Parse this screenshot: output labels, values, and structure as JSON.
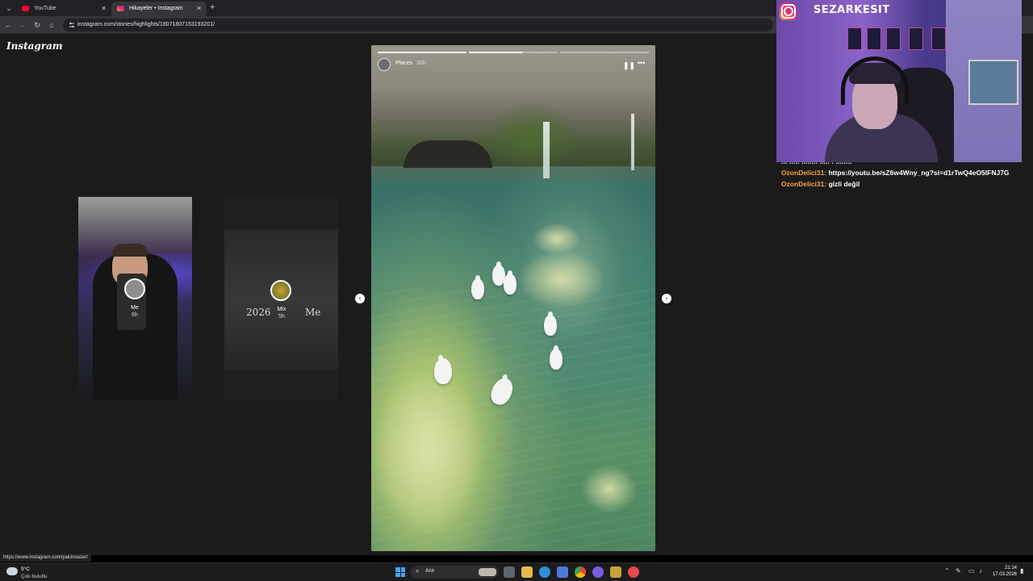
{
  "browser": {
    "tabs": [
      {
        "title": "YouTube",
        "active": false,
        "favicon_color": "#ff0033"
      },
      {
        "title": "Hikayeler • Instagram",
        "active": true,
        "favicon_color": "#e1306c"
      }
    ],
    "url": "instagram.com/stories/highlights/18071807153193201/",
    "status_url": "https://www.instagram.com/yalcinsezer/"
  },
  "instagram": {
    "logo": "Instagram",
    "side_stories": [
      {
        "name": "Me",
        "time": "6h"
      },
      {
        "name": "Mix",
        "time": "5h",
        "caption_left": "2026",
        "caption_right": "Me"
      }
    ],
    "main_story": {
      "author": "Places",
      "time": "30h",
      "progress_segments": 3,
      "progress_fill_current": 0.6,
      "controls": {
        "pause_icon": "pause-icon",
        "more_icon": "more-icon"
      }
    }
  },
  "overlay": {
    "handle": "SEZARKESIT",
    "chat": {
      "cut_line": "... ..... ........ ..... . ........",
      "messages": [
        {
          "user": "OzonDelici31:",
          "text": "https://youtu.be/sZ6w4Wny_ng?si=d1rTwQ4eO5lFNJ7G"
        },
        {
          "user": "OzonDelici31:",
          "text": "gizli değil"
        }
      ]
    }
  },
  "taskbar": {
    "weather_temp": "9°C",
    "weather_desc": "Çok bulutlu",
    "search_placeholder": "Ara",
    "time": "21:14",
    "date": "17.03.2026"
  }
}
